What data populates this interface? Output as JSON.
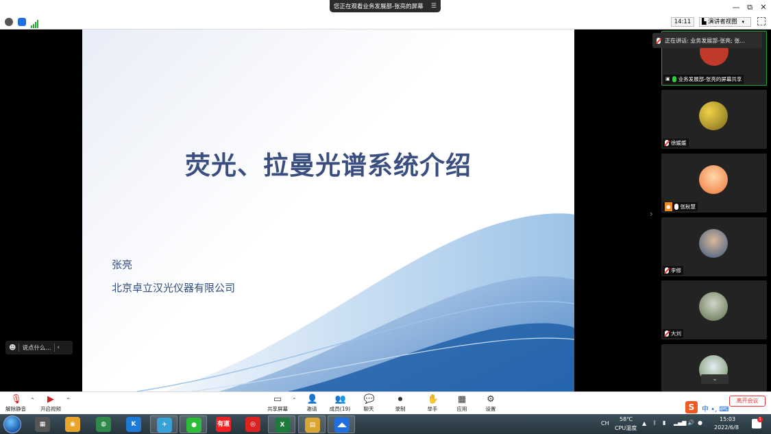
{
  "window": {
    "share_banner": "您正在观看业务发展部-张亮的屏幕",
    "minimize_glyph": "—",
    "restore_glyph": "⧉",
    "close_glyph": "✕"
  },
  "infobar": {
    "meeting_time": "14:11",
    "view_mode": "演讲者视图"
  },
  "slide": {
    "title": "荧光、拉曼光谱系统介绍",
    "presenter": "张亮",
    "company": "北京卓立汉光仪器有限公司"
  },
  "chat": {
    "placeholder": "说点什么..."
  },
  "panel": {
    "speaking_now": "正在讲话: 业务发展部-张亮; 张...",
    "participants": [
      {
        "name": "业务发展部-张亮的屏幕共享",
        "mic": "on"
      },
      {
        "name": "徐媛媛",
        "mic": "muted"
      },
      {
        "name": "张秋慧",
        "mic": "on"
      },
      {
        "name": "李修",
        "mic": "muted"
      },
      {
        "name": "大刘",
        "mic": "muted"
      },
      {
        "name": "",
        "mic": "muted"
      }
    ]
  },
  "toolbar": {
    "unmute": "解除静音",
    "start_video": "开启视频",
    "share_screen": "共享屏幕",
    "invite": "邀请",
    "members": "成员(19)",
    "chat": "聊天",
    "record": "录制",
    "raise_hand": "举手",
    "apps": "应用",
    "settings": "设置",
    "end_meeting": "离开会议",
    "ime_label": "中 •, ⌨"
  },
  "taskbar": {
    "apps": [
      {
        "name": "calculator",
        "label": "▦",
        "color": "#555"
      },
      {
        "name": "browser",
        "label": "◉",
        "color": "#e8a52c"
      },
      {
        "name": "globe",
        "label": "◍",
        "color": "#2f8a4a"
      },
      {
        "name": "k-app",
        "label": "K",
        "color": "#1e7ad6"
      },
      {
        "name": "bird-app",
        "label": "✈",
        "color": "#3aa0d8"
      },
      {
        "name": "wechat",
        "label": "●",
        "color": "#2dbb3a"
      },
      {
        "name": "youdao",
        "label": "有道",
        "color": "#e22"
      },
      {
        "name": "netease-music",
        "label": "◎",
        "color": "#d22"
      },
      {
        "name": "excel",
        "label": "X",
        "color": "#1e7a3c"
      },
      {
        "name": "file-explorer",
        "label": "▤",
        "color": "#d9a633"
      },
      {
        "name": "meeting-app",
        "label": "◢◣",
        "color": "#1f6fe0"
      }
    ],
    "tray": {
      "ch": "CH",
      "cpu_temp": "58℃",
      "cpu_label": "CPU温度",
      "time": "15:03",
      "date": "2022/6/8",
      "notif_count": "1"
    }
  }
}
